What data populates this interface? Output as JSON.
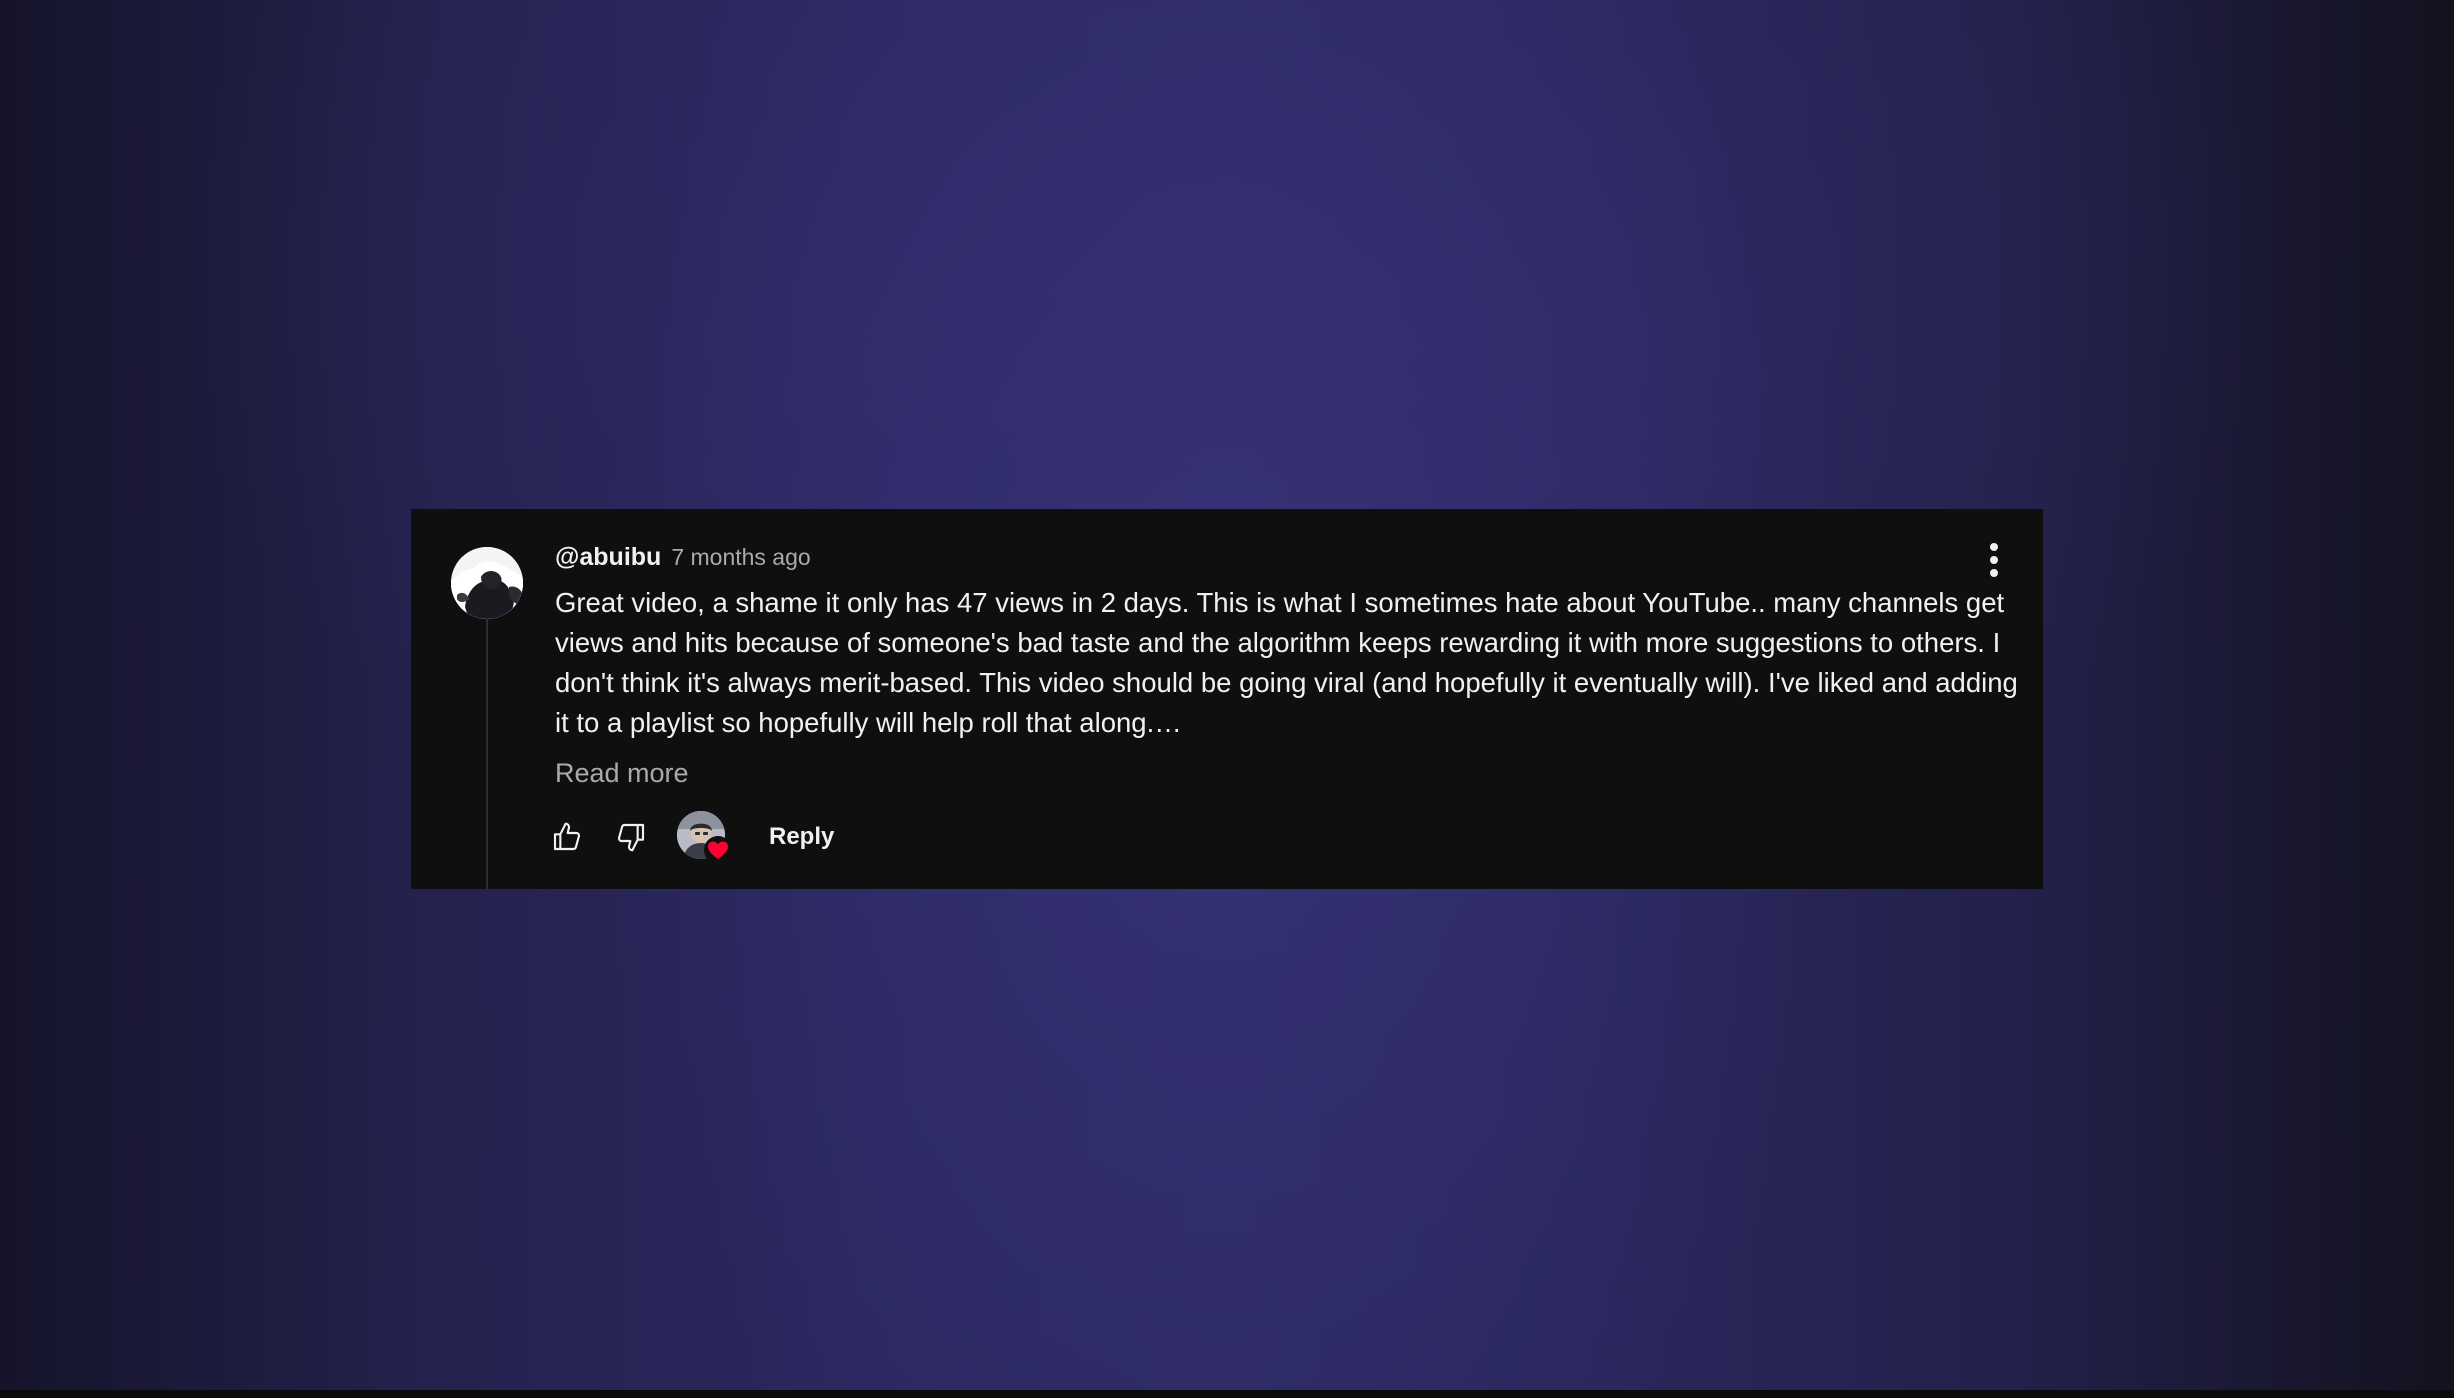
{
  "comment": {
    "author": "@abuibu",
    "timestamp": "7 months ago",
    "text": "Great video, a shame it only has 47 views in 2 days. This is what I sometimes hate about YouTube.. many channels get views and hits because of someone's bad taste and the algorithm keeps rewarding it with more suggestions to others. I don't think it's always merit-based. This video should be going viral (and hopefully it eventually will). I've liked and adding it to a playlist so hopefully will help roll that along.…",
    "read_more_label": "Read more",
    "reply_label": "Reply",
    "hearted_by_creator": true
  },
  "icons": {
    "avatar": "user-avatar",
    "more": "more-vertical-icon",
    "like": "thumbs-up-icon",
    "dislike": "thumbs-down-icon",
    "creator_heart": "heart-icon"
  },
  "colors": {
    "card_background": "#0f0f10",
    "primary_text": "#f1f1f1",
    "secondary_text": "#aaaaaa",
    "heart": "#ff0033",
    "thread_line": "#2e2e3a"
  }
}
